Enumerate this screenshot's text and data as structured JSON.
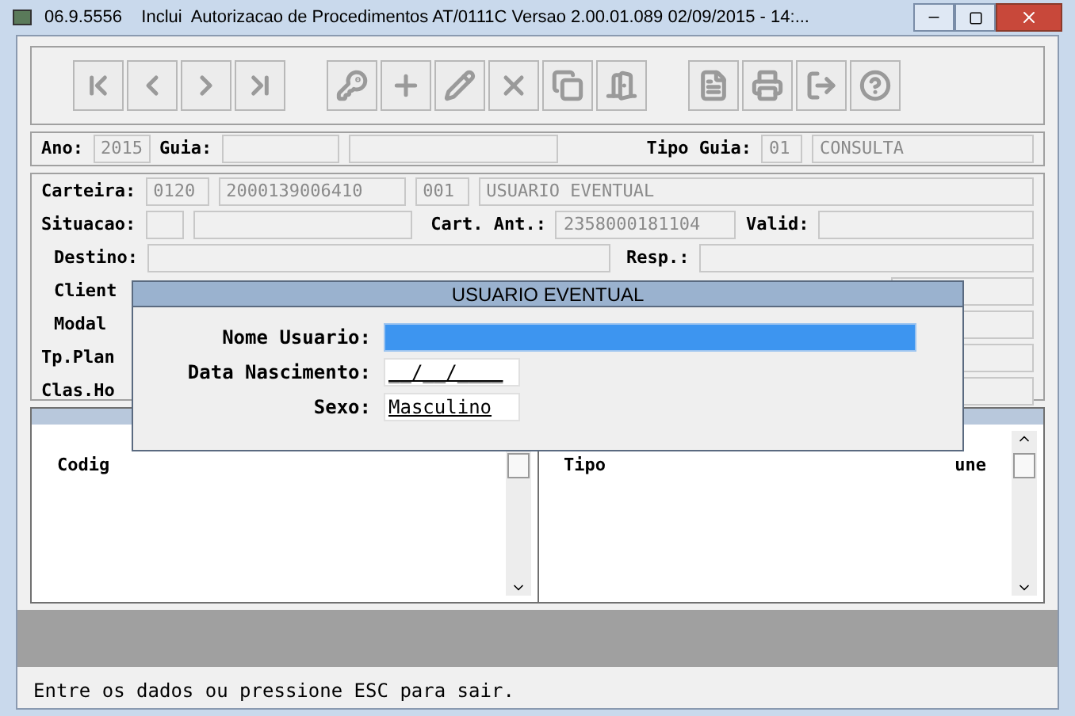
{
  "window": {
    "title": "06.9.5556    Inclui  Autorizacao de Procedimentos AT/0111C Versao 2.00.01.089 02/09/2015 - 14:..."
  },
  "toolbar": [
    {
      "kind": "first",
      "disabled": true
    },
    {
      "kind": "prev",
      "disabled": true
    },
    {
      "kind": "next",
      "disabled": true
    },
    {
      "kind": "last",
      "disabled": true
    },
    {
      "kind": "gap"
    },
    {
      "kind": "search",
      "disabled": true
    },
    {
      "kind": "add",
      "disabled": true
    },
    {
      "kind": "edit",
      "disabled": true
    },
    {
      "kind": "delete",
      "disabled": true
    },
    {
      "kind": "copy",
      "disabled": true
    },
    {
      "kind": "door",
      "disabled": true
    },
    {
      "kind": "gap"
    },
    {
      "kind": "file",
      "disabled": true
    },
    {
      "kind": "print",
      "disabled": true
    },
    {
      "kind": "exit",
      "disabled": true
    },
    {
      "kind": "help",
      "disabled": true
    }
  ],
  "header": {
    "ano_label": "Ano:",
    "ano": "2015",
    "guia_label": "Guia:",
    "tipo_guia_label": "Tipo Guia:",
    "tipo_guia_code": "01",
    "tipo_guia": "CONSULTA"
  },
  "form": {
    "carteira_label": "Carteira:",
    "carteira": [
      "0120",
      "2000139006410",
      "001",
      "USUARIO EVENTUAL"
    ],
    "situacao_label": "Situacao:",
    "cart_ant_label": "Cart. Ant.:",
    "cart_ant": "2358000181104",
    "valid_label": "Valid:",
    "destino_label": "Destino:",
    "resp_label": "Resp.:",
    "covered_labels": [
      "Client",
      "Modal",
      "Tp.Plan",
      "Clas.Ho"
    ]
  },
  "tables": [
    {
      "headers": [
        "Codig"
      ]
    },
    {
      "headers": [
        "Tipo",
        "une"
      ]
    }
  ],
  "dialog": {
    "title": "USUARIO EVENTUAL",
    "fields": [
      {
        "label": "Nome Usuario:",
        "focused": true
      },
      {
        "label": "Data Nascimento:",
        "value": "__/__/____",
        "focused": false
      },
      {
        "label": "Sexo:",
        "value": "Masculino",
        "focused": false
      }
    ]
  },
  "status_bar": "Entre os dados ou pressione ESC para sair."
}
